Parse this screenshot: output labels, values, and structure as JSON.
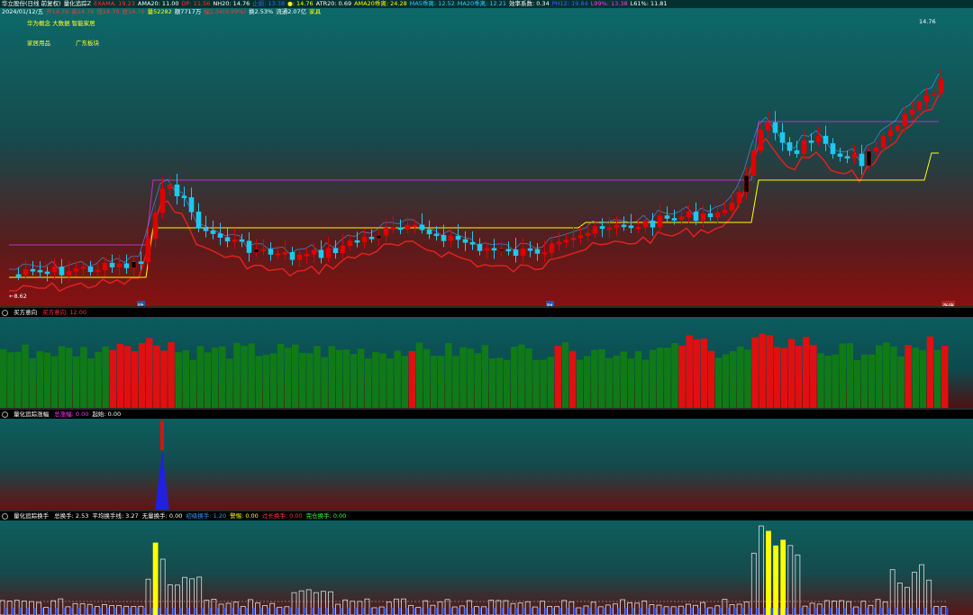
{
  "header": {
    "line1": [
      {
        "text": "华立股份(日线 前复权)",
        "color": "#ffffff"
      },
      {
        "text": "量化追踪Z",
        "color": "#ffffff"
      },
      {
        "text": "EXAMA: 19.23",
        "color": "#ff3333"
      },
      {
        "text": "AMA20: 11.00",
        "color": "#ffffff"
      },
      {
        "text": "DP: 11.56",
        "color": "#ff3333"
      },
      {
        "text": "NH20: 14.76",
        "color": "#ffffff"
      },
      {
        "text": "止损: 13.38",
        "color": "#3366ff"
      },
      {
        "text": "●: 14.76",
        "color": "#ffff00"
      },
      {
        "text": "ATR20: 0.69",
        "color": "#ffffff"
      },
      {
        "text": "AMA20乖离: 24.28",
        "color": "#ffff00"
      },
      {
        "text": "MA5乖离: 12.52",
        "color": "#33ccff"
      },
      {
        "text": "MA20乖离: 12.21",
        "color": "#33ccff"
      },
      {
        "text": "效率系数: 0.34",
        "color": "#ffffff"
      },
      {
        "text": "PH12: 19.84",
        "color": "#3366ff"
      },
      {
        "text": "L99%: 13.38",
        "color": "#ff33ff"
      },
      {
        "text": "L61%: 11.81",
        "color": "#ffffff"
      }
    ],
    "line2": [
      {
        "text": "2024/01/12/五",
        "color": "#ffffff"
      },
      {
        "text": "开14.76",
        "color": "#ff3333"
      },
      {
        "text": "高14.76",
        "color": "#ff3333"
      },
      {
        "text": "低14.70",
        "color": "#ff3333"
      },
      {
        "text": "收14.76",
        "color": "#ff3333"
      },
      {
        "text": "量52282",
        "color": "#ffff00"
      },
      {
        "text": "额7717万",
        "color": "#ffffff"
      },
      {
        "text": "幅1.34(9.99%)",
        "color": "#ff3333"
      },
      {
        "text": "换2.53%",
        "color": "#ffffff"
      },
      {
        "text": "流通2.07亿",
        "color": "#ffffff"
      },
      {
        "text": "家具",
        "color": "#ffff00"
      }
    ],
    "tags": [
      "华为概念 大数据 智能家居",
      "家居用品",
      "广东板块"
    ]
  },
  "main_chart": {
    "price_high_label": "14.76",
    "price_low_label": "8.62",
    "x_markers": [
      "除",
      "财",
      "涨停"
    ]
  },
  "panel2": {
    "title": "买方意向",
    "items": [
      {
        "text": "买方意向: 12.00",
        "color": "#ff3333"
      }
    ]
  },
  "panel3": {
    "title": "量化追踪涨幅",
    "items": [
      {
        "text": "总涨幅: 0.00",
        "color": "#ff33ff"
      },
      {
        "text": "起始: 0.00",
        "color": "#ffffff"
      }
    ]
  },
  "panel4": {
    "title": "量化追踪换手",
    "items": [
      {
        "text": "总换手: 2.53",
        "color": "#ffffff"
      },
      {
        "text": "平均换手线: 3.27",
        "color": "#ffffff"
      },
      {
        "text": "无量换手: 0.00",
        "color": "#ffffff"
      },
      {
        "text": "初级换手: 1.20",
        "color": "#3399ff"
      },
      {
        "text": "警惕: 0.00",
        "color": "#ffff00"
      },
      {
        "text": "过长换手: 0.00",
        "color": "#ff3333"
      },
      {
        "text": "完仓换手: 0.00",
        "color": "#33ff33"
      }
    ]
  },
  "colors": {
    "up": "#e00000",
    "down": "#1ec8f0",
    "vol_up": "#e01010",
    "vol_down": "#107a18",
    "ama": "#ffff00",
    "exama": "#c030c0",
    "trail": "#e02020",
    "ma": "#4aa0ff"
  }
}
